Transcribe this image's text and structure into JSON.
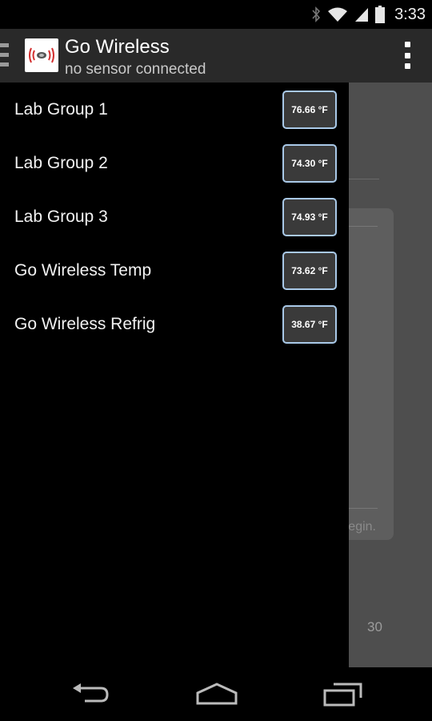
{
  "status_bar": {
    "time": "3:33",
    "icons": [
      "bluetooth-icon",
      "wifi-icon",
      "cell-signal-icon",
      "battery-icon"
    ]
  },
  "action_bar": {
    "title": "Go Wireless",
    "subtitle": "no sensor connected",
    "logo_icon": "wireless-sensor-logo",
    "menu_icon": "overflow-menu-icon"
  },
  "drawer": {
    "sensors": [
      {
        "name": "Lab Group 1",
        "temp": "76.66 °F"
      },
      {
        "name": "Lab Group 2",
        "temp": "74.30 °F"
      },
      {
        "name": "Lab Group 3",
        "temp": "74.93 °F"
      },
      {
        "name": "Go Wireless Temp",
        "temp": "73.62 °F"
      },
      {
        "name": "Go Wireless Refrig",
        "temp": "38.67 °F"
      }
    ]
  },
  "background": {
    "card_text": "egin.",
    "axis_number": "30"
  },
  "nav_bar": {
    "icons": [
      "back-icon",
      "home-icon",
      "recent-apps-icon"
    ]
  },
  "colors": {
    "action_bar_bg": "#292929",
    "badge_border": "#a9c9e8",
    "badge_bg": "#3a3a3a",
    "logo_red": "#d32f2f"
  }
}
